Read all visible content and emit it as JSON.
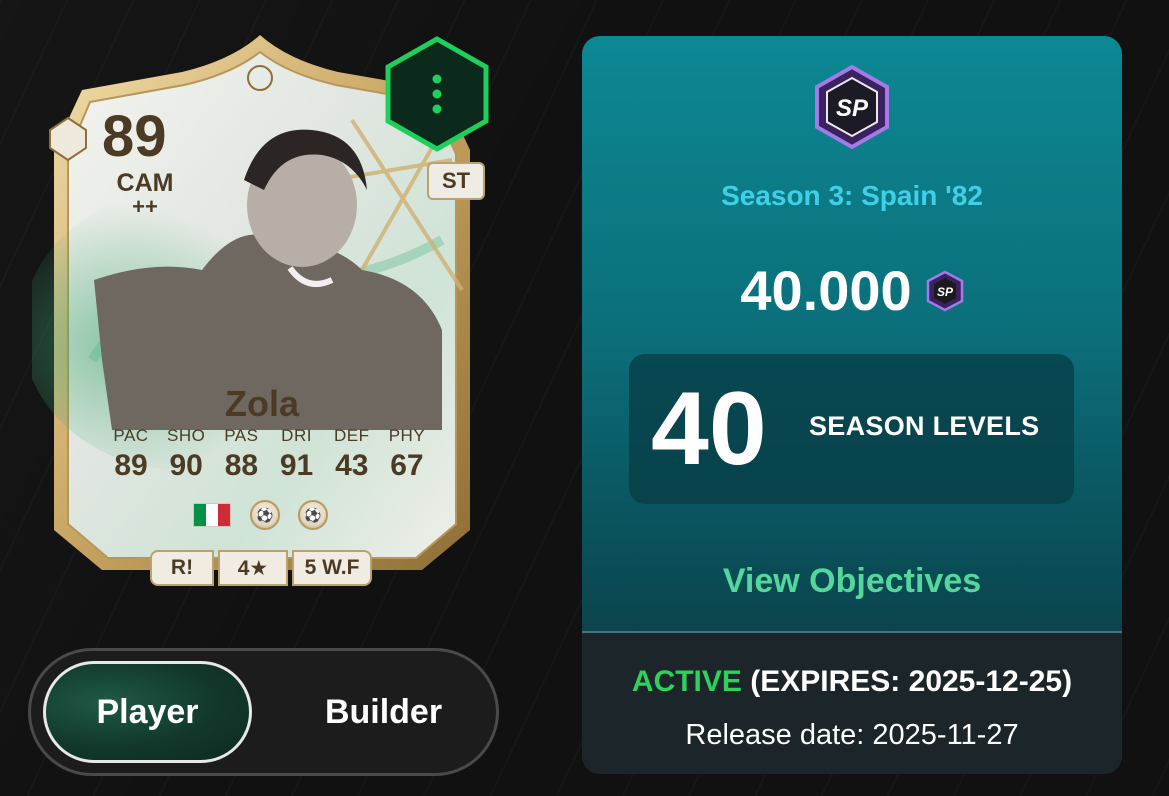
{
  "card": {
    "rating": "89",
    "position": "CAM",
    "position_plus": "++",
    "alt_position": "ST",
    "name": "Zola",
    "stats": [
      {
        "label": "PAC",
        "value": "89"
      },
      {
        "label": "SHO",
        "value": "90"
      },
      {
        "label": "PAS",
        "value": "88"
      },
      {
        "label": "DRI",
        "value": "91"
      },
      {
        "label": "DEF",
        "value": "43"
      },
      {
        "label": "PHY",
        "value": "67"
      }
    ],
    "nation_flag_colors": [
      "#009246",
      "#ffffff",
      "#ce2b37"
    ],
    "skill_tag": "R!",
    "skill_moves": "4★",
    "weak_foot": "5 W.F",
    "menu_icon": "more-vertical-icon",
    "accent_color": "#1ecf5b"
  },
  "toggle": {
    "player_label": "Player",
    "builder_label": "Builder",
    "selected": "Player"
  },
  "season": {
    "logo_text": "SP",
    "name": "Season 3: Spain '82",
    "cost": "40.000",
    "cost_icon_text": "SP",
    "levels_value": "40",
    "levels_label": "SEASON LEVELS",
    "view_objectives": "View Objectives",
    "status": "ACTIVE",
    "expiry": "(EXPIRES: 2025-12-25)",
    "release_date": "Release date: 2025-11-27",
    "colors": {
      "season_name": "#3fd0e8",
      "objectives": "#54d79b",
      "active": "#2ed15b"
    }
  }
}
